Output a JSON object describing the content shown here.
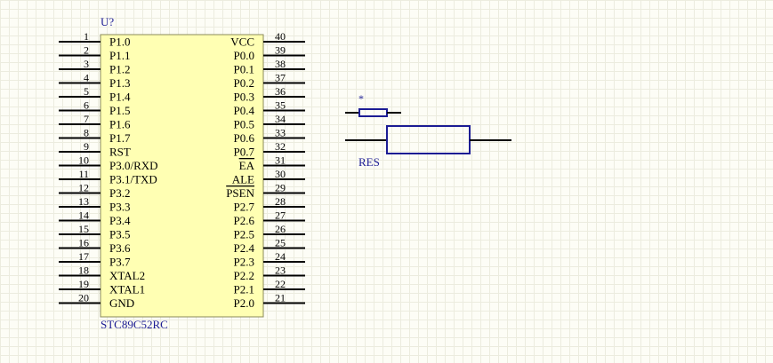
{
  "colors": {
    "background": "#fdfdf6",
    "grid": "#ececdf",
    "ic_body_fill": "#ffffb3",
    "ic_body_stroke": "#8a8a5a",
    "pin_wire": "#000000",
    "resistor": "#1c1c94",
    "label_text": "#1c1c94"
  },
  "ic": {
    "designator": "U?",
    "comment": "STC89C52RC",
    "left_pins": [
      {
        "num": "1",
        "name": "P1.0",
        "overline": false
      },
      {
        "num": "2",
        "name": "P1.1",
        "overline": false
      },
      {
        "num": "3",
        "name": "P1.2",
        "overline": false
      },
      {
        "num": "4",
        "name": "P1.3",
        "overline": false
      },
      {
        "num": "5",
        "name": "P1.4",
        "overline": false
      },
      {
        "num": "6",
        "name": "P1.5",
        "overline": false
      },
      {
        "num": "7",
        "name": "P1.6",
        "overline": false
      },
      {
        "num": "8",
        "name": "P1.7",
        "overline": false
      },
      {
        "num": "9",
        "name": "RST",
        "overline": false
      },
      {
        "num": "10",
        "name": "P3.0/RXD",
        "overline": false
      },
      {
        "num": "11",
        "name": "P3.1/TXD",
        "overline": false
      },
      {
        "num": "12",
        "name": "P3.2",
        "overline": false
      },
      {
        "num": "13",
        "name": "P3.3",
        "overline": false
      },
      {
        "num": "14",
        "name": "P3.4",
        "overline": false
      },
      {
        "num": "15",
        "name": "P3.5",
        "overline": false
      },
      {
        "num": "16",
        "name": "P3.6",
        "overline": false
      },
      {
        "num": "17",
        "name": "P3.7",
        "overline": false
      },
      {
        "num": "18",
        "name": "XTAL2",
        "overline": false
      },
      {
        "num": "19",
        "name": "XTAL1",
        "overline": false
      },
      {
        "num": "20",
        "name": "GND",
        "overline": false
      }
    ],
    "right_pins": [
      {
        "num": "40",
        "name": "VCC",
        "overline": false
      },
      {
        "num": "39",
        "name": "P0.0",
        "overline": false
      },
      {
        "num": "38",
        "name": "P0.1",
        "overline": false
      },
      {
        "num": "37",
        "name": "P0.2",
        "overline": false
      },
      {
        "num": "36",
        "name": "P0.3",
        "overline": false
      },
      {
        "num": "35",
        "name": "P0.4",
        "overline": false
      },
      {
        "num": "34",
        "name": "P0.5",
        "overline": false
      },
      {
        "num": "33",
        "name": "P0.6",
        "overline": false
      },
      {
        "num": "32",
        "name": "P0.7",
        "overline": false
      },
      {
        "num": "31",
        "name": "EA",
        "overline": true
      },
      {
        "num": "30",
        "name": "ALE",
        "overline": false
      },
      {
        "num": "29",
        "name": "PSEN",
        "overline": true
      },
      {
        "num": "28",
        "name": "P2.7",
        "overline": false
      },
      {
        "num": "27",
        "name": "P2.6",
        "overline": false
      },
      {
        "num": "26",
        "name": "P2.5",
        "overline": false
      },
      {
        "num": "25",
        "name": "P2.4",
        "overline": false
      },
      {
        "num": "24",
        "name": "P2.3",
        "overline": false
      },
      {
        "num": "23",
        "name": "P2.2",
        "overline": false
      },
      {
        "num": "22",
        "name": "P2.1",
        "overline": false
      },
      {
        "num": "21",
        "name": "P2.0",
        "overline": false
      }
    ]
  },
  "small_resistor": {
    "label": "*"
  },
  "large_resistor": {
    "label": "RES"
  }
}
